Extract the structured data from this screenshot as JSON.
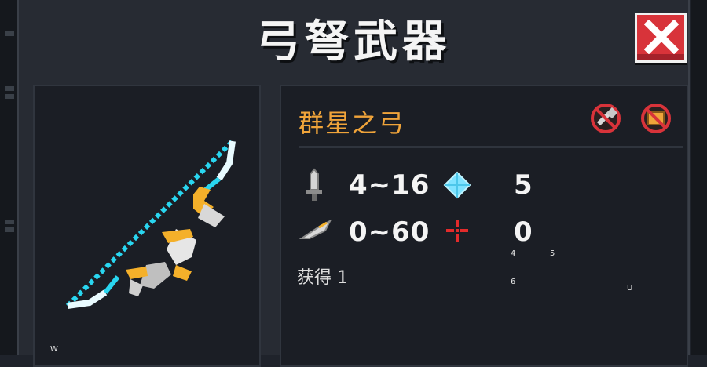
{
  "dialog": {
    "title": "弓弩武器",
    "close_icon": "close-x-icon"
  },
  "weapon": {
    "name": "群星之弓",
    "image_icon": "star-bow-icon",
    "badges": [
      "no-hammer-icon",
      "no-chest-icon"
    ],
    "stats": {
      "damage": "4~16",
      "energy": "5",
      "crit": "0~60",
      "accuracy": "0"
    },
    "acquired": "获得 1"
  },
  "overlay_labels": {
    "a": "4",
    "b": "5",
    "c": "6",
    "d": "U",
    "e": "W"
  },
  "colors": {
    "accent_orange": "#f0a43a",
    "close_red": "#d8333a",
    "bow_cyan": "#29d6f0"
  }
}
